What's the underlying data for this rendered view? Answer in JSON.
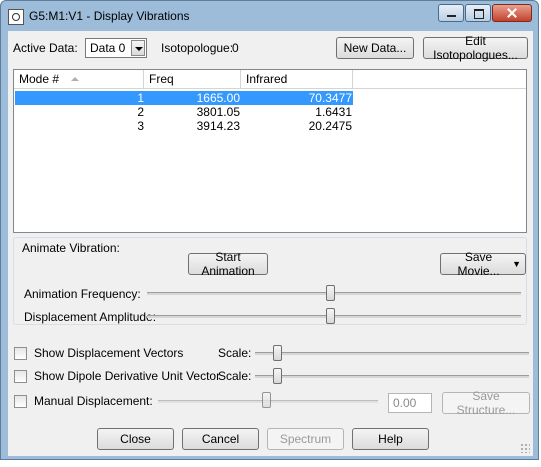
{
  "window": {
    "title": "G5:M1:V1 - Display Vibrations"
  },
  "top": {
    "active_data_label": "Active Data:",
    "active_data_value": "Data 0",
    "isotopologue_label": "Isotopologue:",
    "isotopologue_value": "0",
    "new_data_button": "New Data...",
    "edit_isotopologues_button": "Edit Isotopologues..."
  },
  "table": {
    "columns": [
      "Mode #",
      "Freq",
      "Infrared"
    ],
    "rows": [
      {
        "mode": "1",
        "freq": "1665.00",
        "infrared": "70.3477",
        "selected": true
      },
      {
        "mode": "2",
        "freq": "3801.05",
        "infrared": "1.6431",
        "selected": false
      },
      {
        "mode": "3",
        "freq": "3914.23",
        "infrared": "20.2475",
        "selected": false
      }
    ]
  },
  "animate": {
    "group_label": "Animate Vibration:",
    "start_button": "Start Animation",
    "save_movie_button": "Save Movie...",
    "frequency_label": "Animation Frequency:",
    "frequency_level": 0.49,
    "amplitude_label": "Displacement Amplitude:",
    "amplitude_level": 0.49
  },
  "options": {
    "show_displacement_vectors": "Show Displacement Vectors",
    "displacement_scale_label": "Scale:",
    "displacement_scale_level": 0.08,
    "show_dipole_vector": "Show Dipole Derivative Unit Vector",
    "dipole_scale_label": "Scale:",
    "dipole_scale_level": 0.08,
    "manual_displacement": "Manual Displacement:",
    "manual_displacement_value": "0.00",
    "save_structure_button": "Save Structure..."
  },
  "buttons": {
    "close": "Close",
    "cancel": "Cancel",
    "spectrum": "Spectrum",
    "help": "Help"
  }
}
